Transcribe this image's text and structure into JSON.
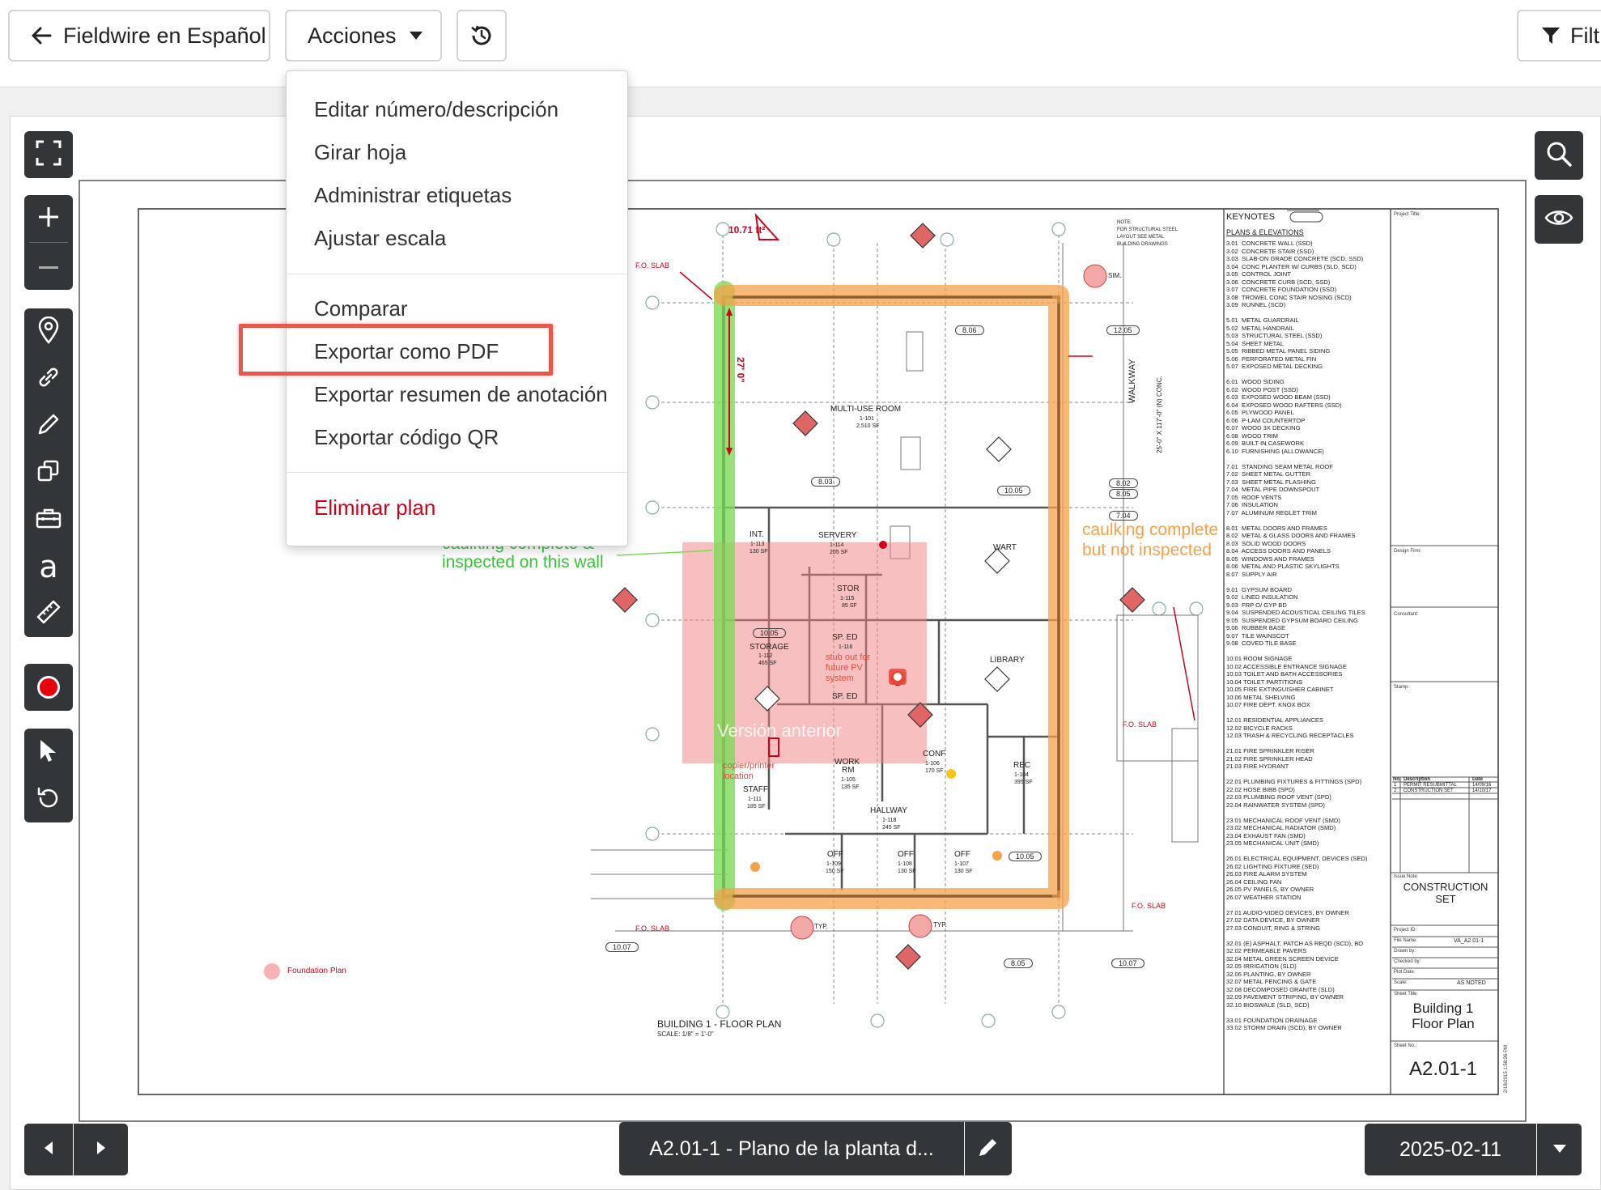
{
  "header": {
    "back_label": "Fieldwire en Español",
    "actions_label": "Acciones",
    "filter_label": "Filt"
  },
  "menu": {
    "items": [
      "Editar número/descripción",
      "Girar hoja",
      "Administrar etiquetas",
      "Ajustar escala",
      "Comparar",
      "Exportar como PDF",
      "Exportar resumen de anotación",
      "Exportar código QR"
    ],
    "danger_item": "Eliminar plan"
  },
  "plan": {
    "annot_green_left": "caulking complete &",
    "annot_green_left2": "inspected on this wall",
    "annot_orange_1": "caulking complete",
    "annot_orange_2": "but not inspected",
    "area_label": "10.71 ft²",
    "dim_vertical": "27' 0\"",
    "rooms": {
      "multi_use": "MULTI-USE ROOM",
      "multi_use_num": "1-101",
      "multi_use_sf": "2,510 SF",
      "int": "INT.",
      "int_num": "1-113",
      "int_sf": "130 SF",
      "servery": "SERVERY",
      "servery_num": "1-114",
      "servery_sf": "205 SF",
      "stor": "STOR",
      "stor_num": "1-115",
      "stor_sf": "85 SF",
      "storage": "STORAGE",
      "storage_num": "1-112",
      "storage_sf": "465 SF",
      "sped1": "SP. ED",
      "sped1_num": "1-116",
      "sped2": "SP. ED",
      "stub": "stub out for",
      "stub2": "future PV",
      "stub3": "system",
      "wart": "WART",
      "library": "LIBRARY",
      "conf": "CONF",
      "conf_num": "1-106",
      "conf_sf": "170 SF",
      "work": "WORK",
      "work2": "RM",
      "work_num": "1-105",
      "work_sf": "135 SF",
      "staff": "STAFF",
      "staff_num": "1-111",
      "staff_sf": "185 SF",
      "rec": "REC",
      "rec_num": "1-104",
      "rec_sf": "395 SF",
      "hallway": "HALLWAY",
      "hallway_num": "1-118",
      "hallway_sf": "245 SF",
      "off1": "OFF",
      "off1_num": "1-109",
      "off1_sf": "150 SF",
      "off2": "OFF",
      "off2_num": "1-108",
      "off2_sf": "130 SF",
      "off3": "OFF",
      "off3_num": "1-107",
      "off3_sf": "130 SF",
      "copier": "copier/printer",
      "copier2": "location",
      "version": "Versión anterior"
    },
    "labels": {
      "fo_slab": "F.O. SLAB",
      "walkway": "WALKWAY",
      "walkway_conc": "25'-0\" X 117'-0\" (N) CONC.",
      "note": "NOTE:",
      "note1": "FOR STRUCTURAL STEEL",
      "note2": "LAYOUT SEE METAL",
      "note3": "BUILDING DRAWINGS",
      "sim": "SIM.",
      "typ": "TYP.",
      "foundation": "Foundation Plan",
      "floor_plan_title": "BUILDING 1 - FLOOR PLAN",
      "scale": "SCALE: 1/8\" = 1'-0\""
    },
    "tags": [
      "8.06",
      "8.03",
      "10.05",
      "12.05",
      "8.02",
      "8.05",
      "7.04",
      "10.05",
      "10.07",
      "8.05",
      "10.07",
      "10.05"
    ],
    "keynotes": {
      "title": "KEYNOTES",
      "section": "PLANS & ELEVATIONS",
      "lines": [
        "3.01  CONCRETE WALL (SSD)",
        "3.02  CONCRETE STAIR (SSD)",
        "3.03  SLAB-ON GRADE CONCRETE (SCD, SSD)",
        "3.04  CONC PLANTER W/ CURBS (SLD, SCD)",
        "3.05  CONTROL JOINT",
        "3.06  CONCRETE CURB (SCD, SSD)",
        "3.07  CONCRETE FOUNDATION (SSD)",
        "3.08  TROWEL CONC STAIR NOSING (SCD)",
        "3.09  RUNNEL (SCD)",
        "",
        "5.01  METAL GUARDRAIL",
        "5.02  METAL HANDRAIL",
        "5.03  STRUCTURAL STEEL (SSD)",
        "5.04  SHEET METAL",
        "5.05  RIBBED METAL PANEL SIDING",
        "5.06  PERFORATED METAL FIN",
        "5.07  EXPOSED METAL DECKING",
        "",
        "6.01  WOOD SIDING",
        "6.02  WOOD POST (SSD)",
        "6.03  EXPOSED WOOD BEAM (SSD)",
        "6.04  EXPOSED WOOD RAFTERS (SSD)",
        "6.05  PLYWOOD PANEL",
        "6.06  P-LAM COUNTERTOP",
        "6.07  WOOD 3X DECKING",
        "6.08  WOOD TRIM",
        "6.09  BUILT-IN CASEWORK",
        "6.10  FURNISHING (ALLOWANCE)",
        "",
        "7.01  STANDING SEAM METAL ROOF",
        "7.02  SHEET METAL GUTTER",
        "7.03  SHEET METAL FLASHING",
        "7.04  METAL PIPE DOWNSPOUT",
        "7.05  ROOF VENTS",
        "7.06  INSULATION",
        "7.07  ALUMINUM REGLET TRIM",
        "",
        "8.01  METAL DOORS AND FRAMES",
        "8.02  METAL & GLASS DOORS AND FRAMES",
        "8.03  SOLID WOOD DOORS",
        "8.04  ACCESS DOORS AND PANELS",
        "8.05  WINDOWS AND FRAMES",
        "8.06  METAL AND PLASTIC SKYLIGHTS",
        "8.07  SUPPLY AIR",
        "",
        "9.01  GYPSUM BOARD",
        "9.02  LINED INSULATION",
        "9.03  FRP O/ GYP BD",
        "9.04  SUSPENDED ACOUSTICAL CEILING TILES",
        "9.05  SUSPENDED GYPSUM BOARD CEILING",
        "9.06  RUBBER BASE",
        "9.07  TILE WAINSCOT",
        "9.08  COVED TILE BASE",
        "",
        "10.01 ROOM SIGNAGE",
        "10.02 ACCESSIBLE ENTRANCE SIGNAGE",
        "10.03 TOILET AND BATH ACCESSORIES",
        "10.04 TOILET PARTITIONS",
        "10.05 FIRE EXTINGUISHER CABINET",
        "10.06 METAL SHELVING",
        "10.07 FIRE DEPT. KNOX BOX",
        "",
        "12.01 RESIDENTIAL APPLIANCES",
        "12.02 BICYCLE RACKS",
        "12.03 TRASH & RECYCLING RECEPTACLES",
        "",
        "21.01 FIRE SPRINKLER RISER",
        "21.02 FIRE SPRINKLER HEAD",
        "21.03 FIRE HYDRANT",
        "",
        "22.01 PLUMBING FIXTURES & FITTINGS (SPD)",
        "22.02 HOSE BIBB (SPD)",
        "22.03 PLUMBING ROOF VENT (SPD)",
        "22.04 RAINWATER SYSTEM (SPD)",
        "",
        "23.01 MECHANICAL ROOF VENT (SMD)",
        "23.02 MECHANICAL RADIATOR (SMD)",
        "23.04 EXHAUST FAN (SMD)",
        "23.05 MECHANICAL UNIT (SMD)",
        "",
        "26.01 ELECTRICAL EQUIPMENT, DEVICES (SED)",
        "26.02 LIGHTING FIXTURE (SED)",
        "26.03 FIRE ALARM SYSTEM",
        "26.04 CEILING FAN",
        "26.05 PV PANELS, BY OWNER",
        "26.07 WEATHER STATION",
        "",
        "27.01 AUDIO-VIDEO DEVICES, BY OWNER",
        "27.02 DATA DEVICE, BY OWNER",
        "27.03 CONDUIT, RING & STRING",
        "",
        "32.01 (E) ASPHALT, PATCH AS REQD (SCD), BO",
        "32.02 PERMEABLE PAVERS",
        "32.04 METAL GREEN SCREEN DEVICE",
        "32.05 IRRIGATION (SLD)",
        "32.06 PLANTING, BY OWNER",
        "32.07 METAL FENCING & GATE",
        "32.08 DECOMPOSED GRANITE (SLD)",
        "32.09 PAVEMENT STRIPING, BY OWNER",
        "32.10 BIOSWALE (SLD, SCD)",
        "",
        "33.01 FOUNDATION DRAINAGE",
        "33.02 STORM DRAIN (SCD), BY OWNER"
      ]
    },
    "titleblock": {
      "project_title": "Project Title:",
      "design_firm": "Design Firm:",
      "consultant": "Consultant:",
      "stamp": "Stamp:",
      "rev_no": "No.",
      "rev_desc": "Description",
      "rev_date": "Date",
      "rev1_no": "1",
      "rev1_desc": "PERMIT RESUBMITTAL",
      "rev1_date": "14/09/16",
      "rev2_no": "2",
      "rev2_desc": "CONSTRUCTION SET",
      "rev2_date": "14/10/17",
      "issue_note": "Issue Note:",
      "issue": "CONSTRUCTION SET",
      "project_id": "Project ID:",
      "file_name": "File Name:",
      "file_value": "VA_A2.01-1",
      "drawn_by": "Drawn by:",
      "checked_by": "Checked by:",
      "plot_date": "Plot Date:",
      "scale": "Scale:",
      "scale_value": "AS NOTED",
      "sheet_title": "Sheet Title:",
      "sheet_title_value1": "Building 1",
      "sheet_title_value2": "Floor Plan",
      "sheet_no": "Sheet No.:",
      "sheet_no_value": "A2.01-1",
      "date_stamp": "2/18/2015 1:58:26 PM"
    }
  },
  "footer": {
    "sheet_name": "A2.01-1 - Plano de la planta d...",
    "version_date": "2025-02-11"
  },
  "colors": {
    "toolbar": "#333638",
    "danger": "#d0021b",
    "highlight": "#e9564a",
    "green": "#7ed957",
    "orange": "#f5a04b"
  }
}
